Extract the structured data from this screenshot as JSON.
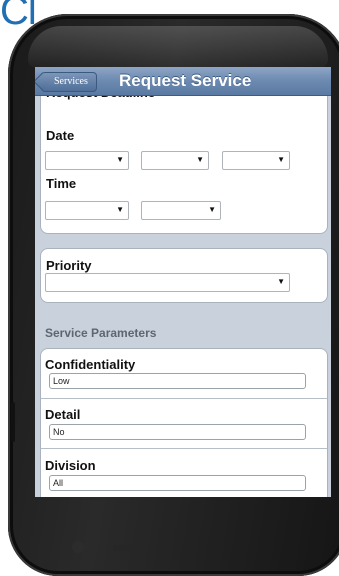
{
  "logo_fragment": "Cl",
  "nav": {
    "back_label": "Services",
    "title": "Request Service"
  },
  "deadline": {
    "heading": "Request Deadline",
    "date_label": "Date",
    "time_label": "Time"
  },
  "priority": {
    "label": "Priority",
    "value": ""
  },
  "service_parameters": {
    "header": "Service Parameters",
    "fields": [
      {
        "label": "Confidentiality",
        "value": "Low"
      },
      {
        "label": "Detail",
        "value": "No"
      },
      {
        "label": "Division",
        "value": "All"
      }
    ]
  },
  "icons": {
    "select_arrow": "chevron-down-icon"
  },
  "colors": {
    "nav_bar": "#6c89b0",
    "page_background": "#c9d2dc",
    "phone_body": "#1a1a1a",
    "logo": "#1f6fb2"
  }
}
